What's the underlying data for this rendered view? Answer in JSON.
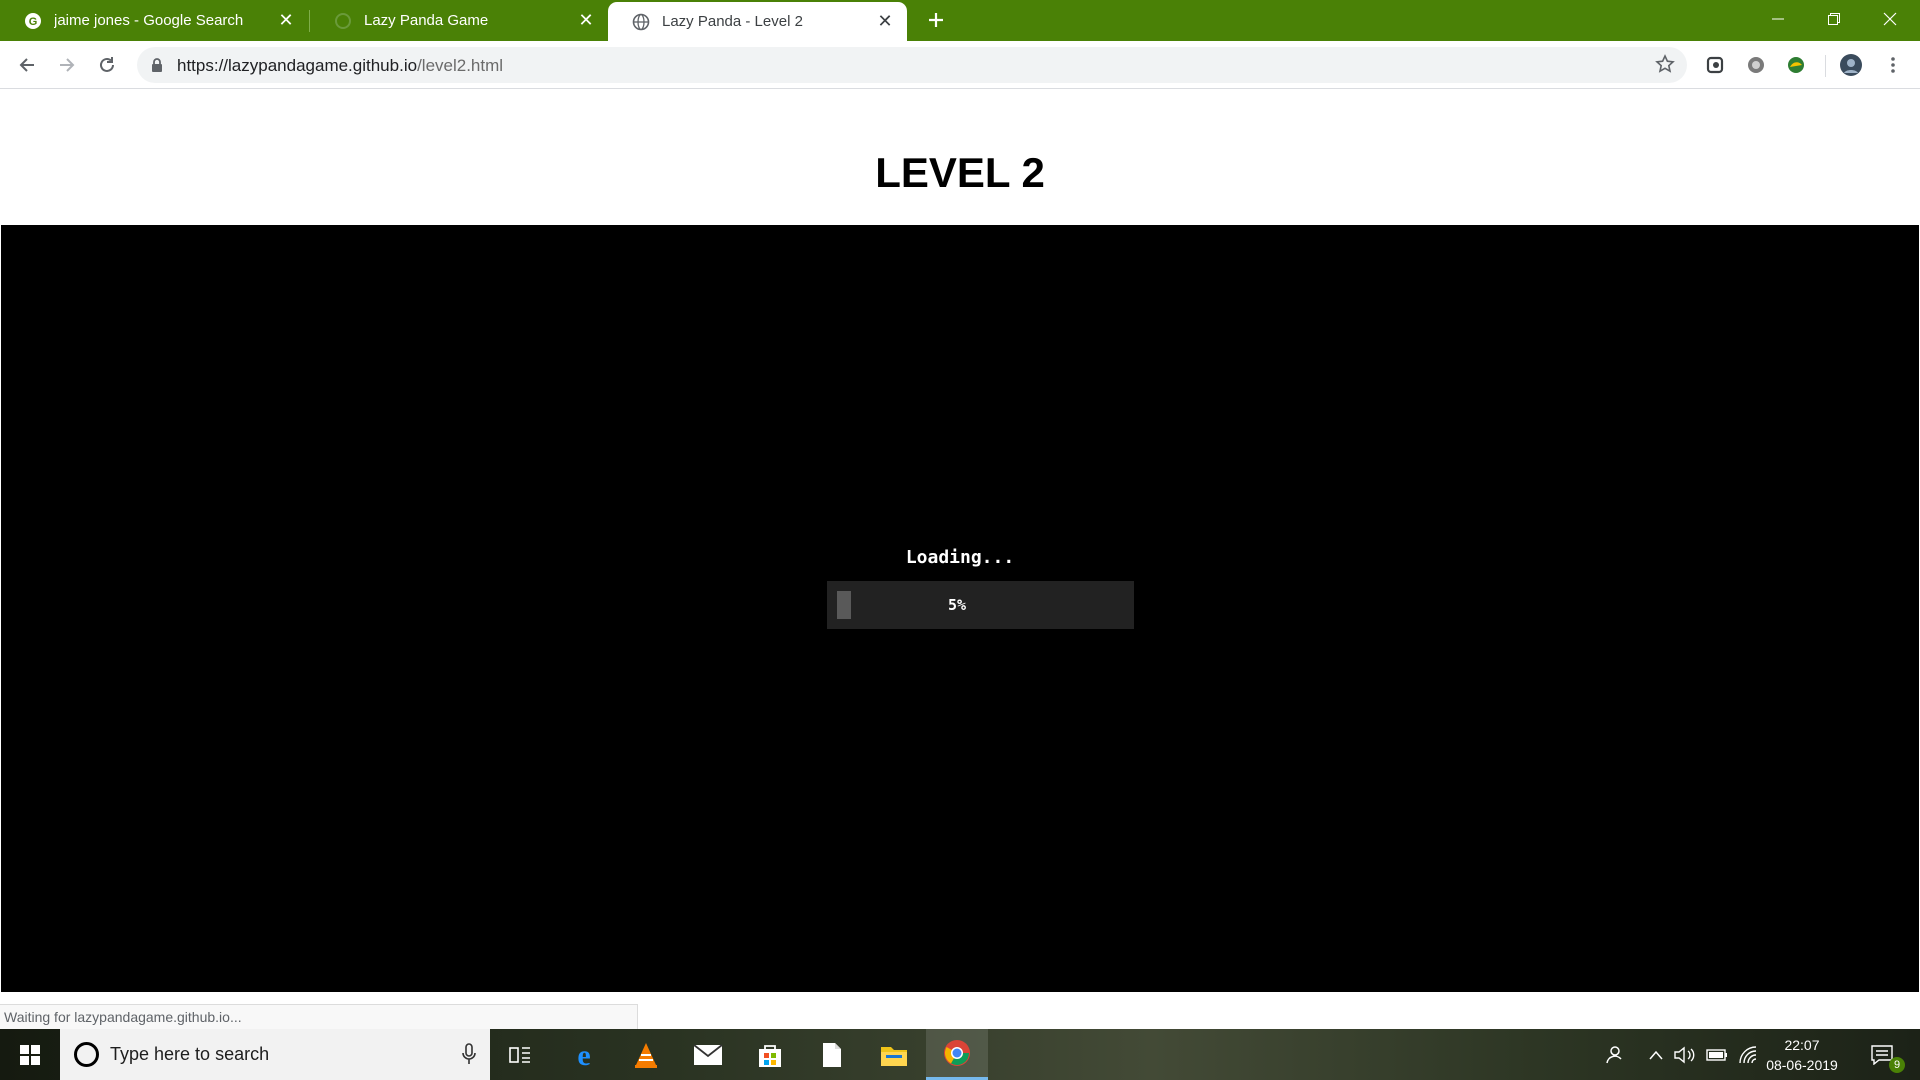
{
  "browser": {
    "tabs": [
      {
        "title": "jaime jones - Google Search",
        "favicon": "google-icon",
        "active": false
      },
      {
        "title": "Lazy Panda Game",
        "favicon": "loading-spinner-icon",
        "active": false
      },
      {
        "title": "Lazy Panda - Level 2",
        "favicon": "globe-icon",
        "active": true
      }
    ],
    "url_host": "https://lazypandagame.github.io",
    "url_path": "/level2.html",
    "accent_color": "#4a8106"
  },
  "page": {
    "heading": "LEVEL 2",
    "loading_label": "Loading...",
    "progress_percent": 5,
    "progress_label": "5%"
  },
  "status_bar": {
    "text": "Waiting for lazypandagame.github.io..."
  },
  "taskbar": {
    "search_placeholder": "Type here to search",
    "time": "22:07",
    "date": "08-06-2019",
    "notification_count": "9",
    "apps": [
      "task-view-icon",
      "edge-icon",
      "vlc-icon",
      "mail-icon",
      "store-icon",
      "file-icon",
      "file-explorer-icon",
      "chrome-icon"
    ]
  }
}
